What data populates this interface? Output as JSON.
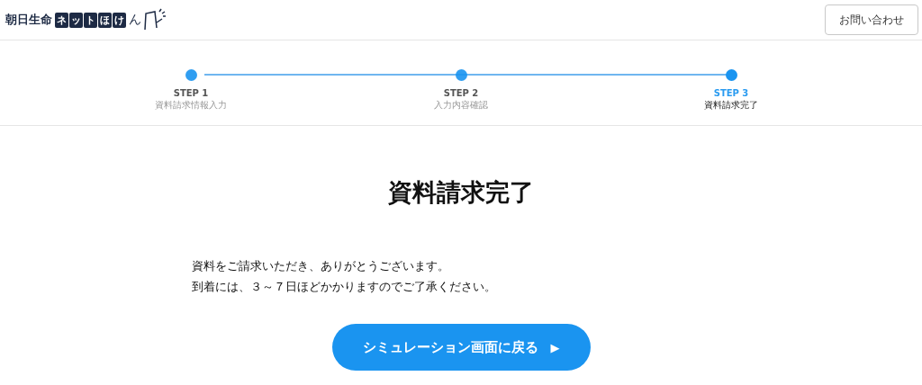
{
  "logo": {
    "brand": "朝日生命",
    "boxed": [
      "ネ",
      "ッ",
      "ト",
      "ほ",
      "け"
    ],
    "tail": "ん"
  },
  "header": {
    "contact_button": "お問い合わせ"
  },
  "steps": [
    {
      "label": "STEP 1",
      "caption": "資料請求情報入力",
      "selected": false
    },
    {
      "label": "STEP 2",
      "caption": "入力内容確認",
      "selected": false
    },
    {
      "label": "STEP 3",
      "caption": "資料請求完了",
      "selected": true
    }
  ],
  "title": "資料請求完了",
  "message": [
    "資料をご請求いただき、ありがとうございます。",
    "到着には、３～７日ほどかかりますのでご了承ください。"
  ],
  "button": {
    "label": "シミュレーション画面に戻る",
    "icon": "▶"
  }
}
